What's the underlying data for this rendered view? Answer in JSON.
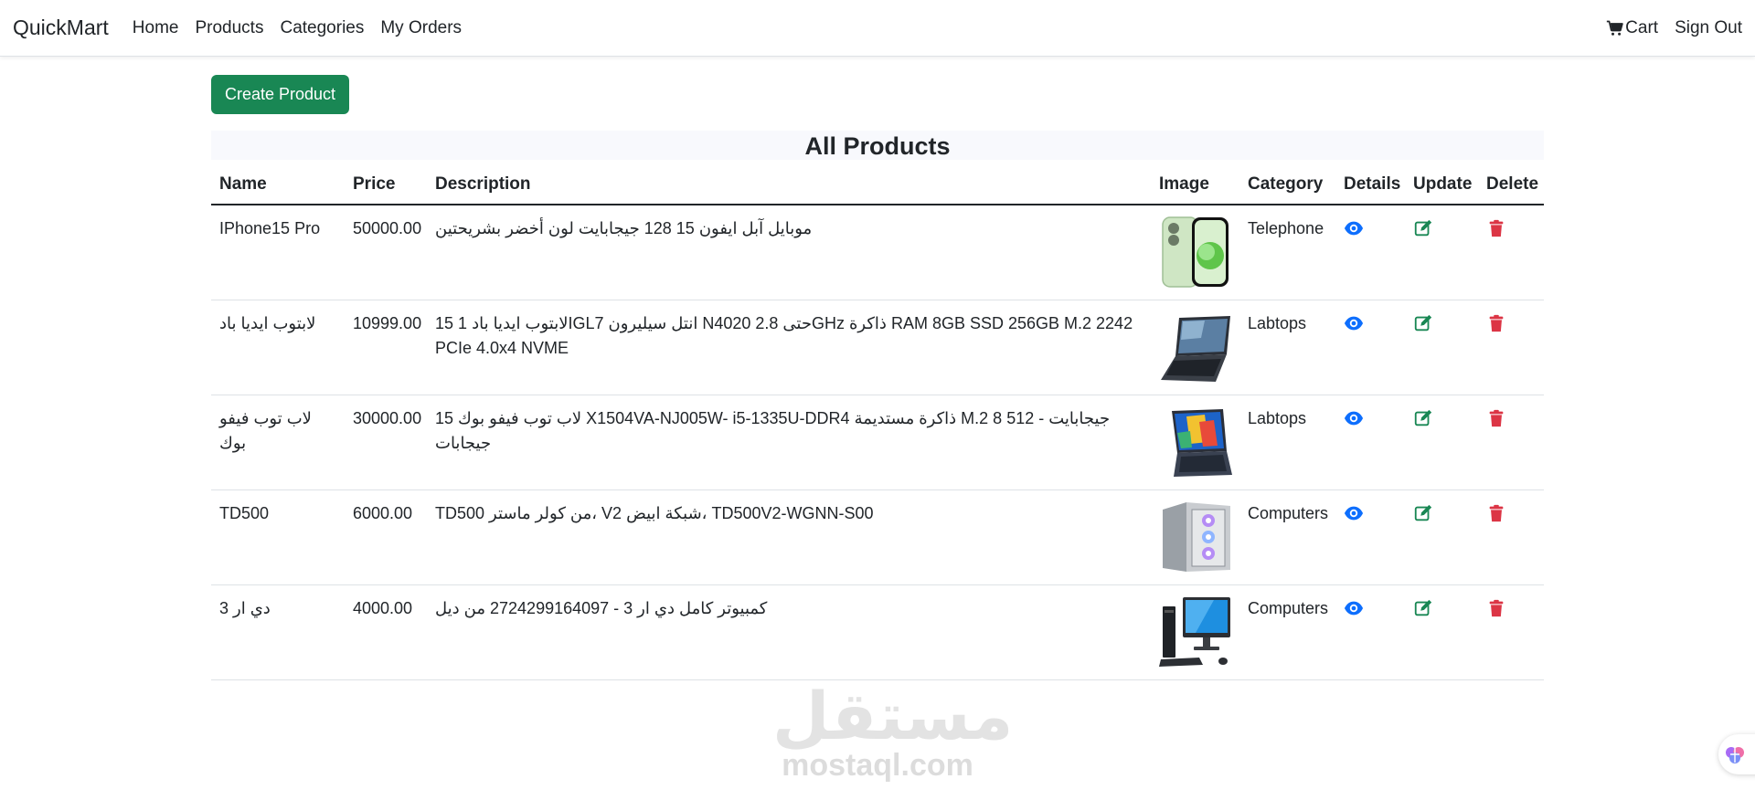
{
  "nav": {
    "brand": "QuickMart",
    "links": [
      "Home",
      "Products",
      "Categories",
      "My Orders"
    ],
    "cart_label": "Cart",
    "signout_label": "Sign Out"
  },
  "actions": {
    "create_label": "Create Product"
  },
  "page": {
    "title": "All Products"
  },
  "table": {
    "headers": [
      "Name",
      "Price",
      "Description",
      "Image",
      "Category",
      "Details",
      "Update",
      "Delete"
    ],
    "rows": [
      {
        "name": "IPhone15 Pro",
        "price": "50000.00",
        "description": "موبايل آبل ايفون 15 128 جيجابايت لون أخضر بشريحتين",
        "image_icon": "iphone-image",
        "category": "Telephone"
      },
      {
        "name": "لابتوب ايديا باد",
        "price": "10999.00",
        "description": "لابتوب ايديا باد 1 15IGL7 انتل سيليرون N4020 حتى 2.8GHz ذاكرة RAM 8GB SSD 256GB M.2 2242 PCIe 4.0x4 NVME",
        "image_icon": "laptop-image",
        "category": "Labtops"
      },
      {
        "name": "لاب توب فيفو بوك",
        "price": "30000.00",
        "description": "لاب توب فيفو بوك 15 X1504VA-NJ005W- i5-1335U-DDR4 ذاكرة مستديمة M.2 8 512 - جيجابايت جيجابات",
        "image_icon": "laptop-image",
        "category": "Labtops"
      },
      {
        "name": "TD500",
        "price": "6000.00",
        "description": "TD500 من كولر ماستر، V2 شبكة ابيض، TD500V2-WGNN-S00",
        "image_icon": "pc-case-image",
        "category": "Computers"
      },
      {
        "name": "دي ار 3",
        "price": "4000.00",
        "description": "كمبيوتر كامل دي ار 3 - 2724299164097 من ديل",
        "image_icon": "desktop-computer-image",
        "category": "Computers"
      }
    ]
  },
  "colors": {
    "create_button": "#198754",
    "details_icon": "#0d6efd",
    "update_icon": "#198754",
    "delete_icon": "#dc3545"
  },
  "watermark": {
    "arabic": "مستقل",
    "latin": "mostaql.com"
  }
}
